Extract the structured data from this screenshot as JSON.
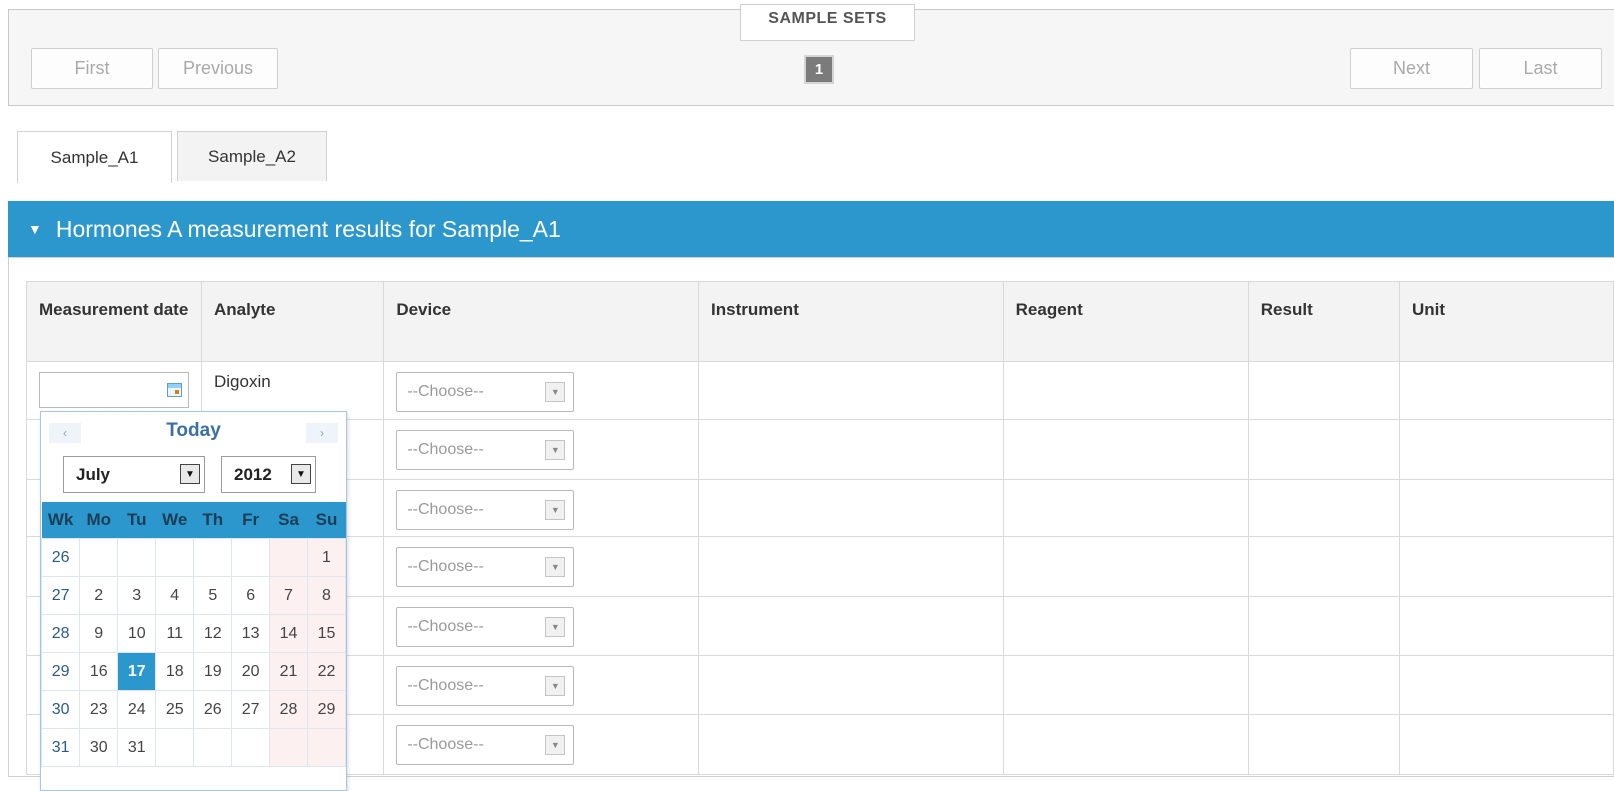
{
  "pager": {
    "legend": "SAMPLE SETS",
    "first": "First",
    "previous": "Previous",
    "page": "1",
    "next": "Next",
    "last": "Last"
  },
  "tabs": [
    {
      "label": "Sample_A1",
      "active": true
    },
    {
      "label": "Sample_A2",
      "active": false
    }
  ],
  "section": {
    "title": "Hormones A measurement results for Sample_A1"
  },
  "table": {
    "headers": [
      "Measurement date",
      "Analyte",
      "Device",
      "Instrument",
      "Reagent",
      "Result",
      "Unit"
    ],
    "rows": [
      {
        "analyte": "Digoxin",
        "device": "--Choose--"
      },
      {
        "analyte": "",
        "device": "--Choose--"
      },
      {
        "analyte": "",
        "device": "--Choose--"
      },
      {
        "analyte": "",
        "device": "--Choose--"
      },
      {
        "analyte": "",
        "device": "--Choose--"
      },
      {
        "analyte": "",
        "device": "--Choose--"
      },
      {
        "analyte": "",
        "device": "--Choose--"
      }
    ]
  },
  "datepicker": {
    "today_label": "Today",
    "prev_glyph": "‹",
    "next_glyph": "›",
    "month": "July",
    "year": "2012",
    "day_headers": [
      "Wk",
      "Mo",
      "Tu",
      "We",
      "Th",
      "Fr",
      "Sa",
      "Su"
    ],
    "weeks": [
      [
        "26",
        "",
        "",
        "",
        "",
        "",
        "",
        "1"
      ],
      [
        "27",
        "2",
        "3",
        "4",
        "5",
        "6",
        "7",
        "8"
      ],
      [
        "28",
        "9",
        "10",
        "11",
        "12",
        "13",
        "14",
        "15"
      ],
      [
        "29",
        "16",
        "17",
        "18",
        "19",
        "20",
        "21",
        "22"
      ],
      [
        "30",
        "23",
        "24",
        "25",
        "26",
        "27",
        "28",
        "29"
      ],
      [
        "31",
        "30",
        "31",
        "",
        "",
        "",
        "",
        ""
      ]
    ],
    "selected_day": "17"
  },
  "colors": {
    "accent": "#2b97cd",
    "header_bg": "#f3f3f3"
  }
}
